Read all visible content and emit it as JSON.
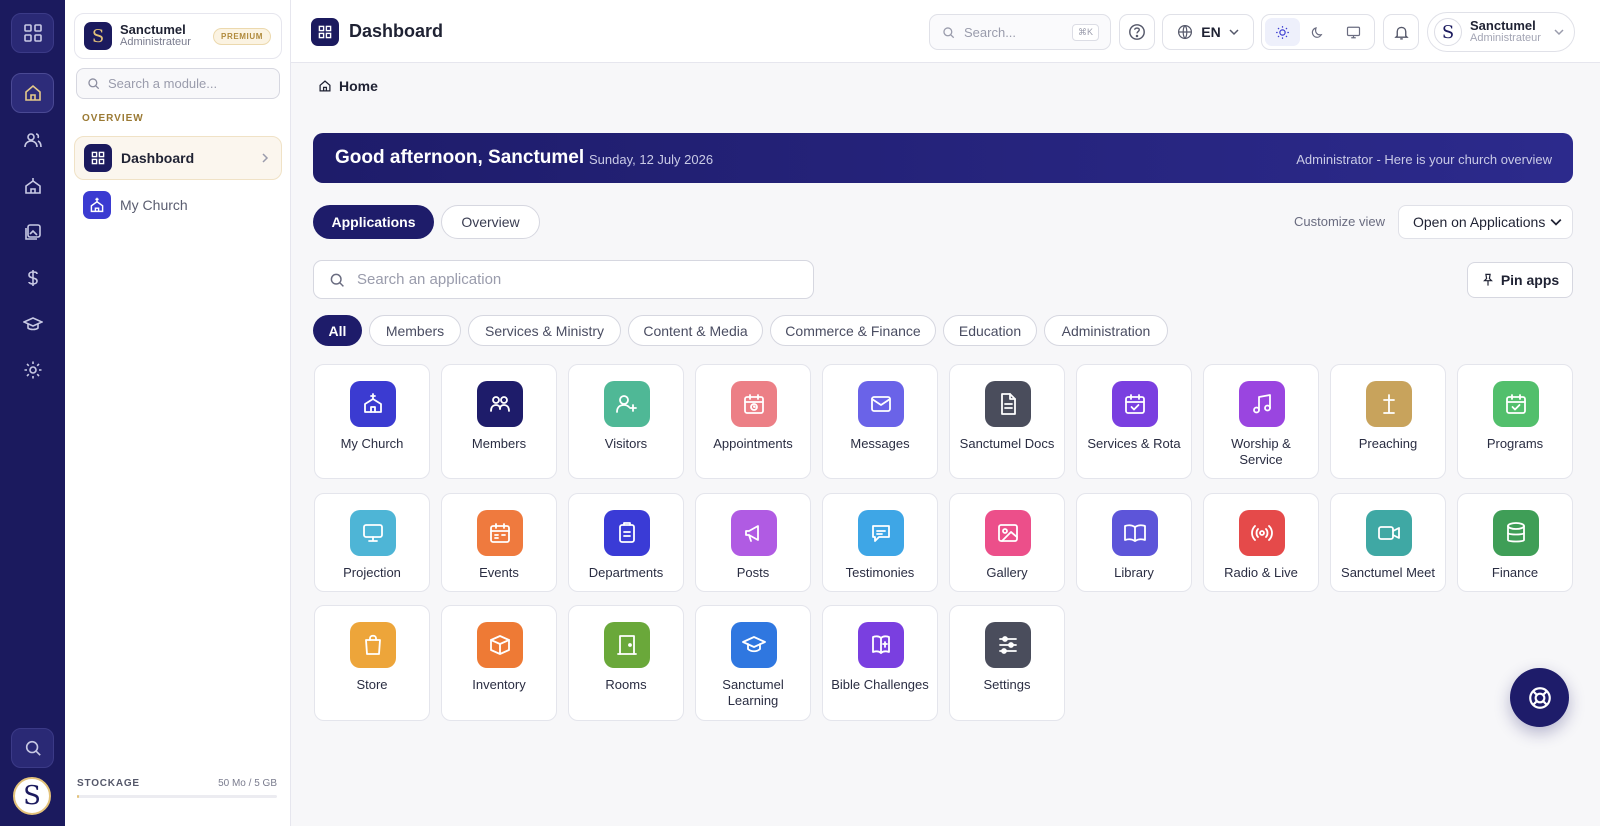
{
  "rail": {
    "items": [
      "apps-grid-icon",
      "home-icon",
      "users-icon",
      "church-icon",
      "media-icon",
      "dollar-icon",
      "graduation-cap-icon",
      "gear-icon"
    ],
    "search_icon": "search-icon",
    "avatar_letter": "S"
  },
  "sidebar": {
    "org_logo": "S",
    "org_name": "Sanctumel",
    "org_role": "Administrateur",
    "badge": "PREMIUM",
    "search_placeholder": "Search a module...",
    "section_label": "OVERVIEW",
    "items": [
      {
        "label": "Dashboard",
        "icon": "dashboard-icon",
        "active": true
      },
      {
        "label": "My Church",
        "icon": "church-icon",
        "active": false
      }
    ],
    "storage_label": "STOCKAGE",
    "storage_value": "50 Mo / 5 GB",
    "storage_fraction": 0.01
  },
  "header": {
    "title": "Dashboard",
    "search_placeholder": "Search...",
    "search_shortcut": "⌘K",
    "language": "EN",
    "user_name": "Sanctumel",
    "user_role": "Administrateur",
    "user_avatar": "S",
    "theme_selected": "light"
  },
  "breadcrumb": {
    "label": "Home"
  },
  "banner": {
    "greeting": "Good afternoon, Sanctumel",
    "date": "Sunday, 12 July 2026",
    "subtitle": "Administrator - Here is your church overview"
  },
  "tabs": [
    {
      "label": "Applications",
      "active": true
    },
    {
      "label": "Overview",
      "active": false
    }
  ],
  "customize": {
    "label": "Customize view",
    "selected": "Open on Applications"
  },
  "app_search": {
    "placeholder": "Search an application"
  },
  "pin_button": {
    "label": "Pin apps"
  },
  "filters": [
    {
      "label": "All",
      "active": true
    },
    {
      "label": "Members",
      "active": false
    },
    {
      "label": "Services & Ministry",
      "active": false
    },
    {
      "label": "Content & Media",
      "active": false
    },
    {
      "label": "Commerce & Finance",
      "active": false
    },
    {
      "label": "Education",
      "active": false
    },
    {
      "label": "Administration",
      "active": false
    }
  ],
  "apps": [
    {
      "label": "My Church",
      "icon": "church-icon",
      "color": "#3b3bd1"
    },
    {
      "label": "Members",
      "icon": "users-icon",
      "color": "#1e1c6a"
    },
    {
      "label": "Visitors",
      "icon": "user-plus-icon",
      "color": "#4fb896"
    },
    {
      "label": "Appointments",
      "icon": "calendar-clock-icon",
      "color": "#ec7f86"
    },
    {
      "label": "Messages",
      "icon": "mail-icon",
      "color": "#6a63e8"
    },
    {
      "label": "Sanctumel Docs",
      "icon": "document-icon",
      "color": "#4a4d5c"
    },
    {
      "label": "Services & Rota",
      "icon": "calendar-check-icon",
      "color": "#7a3fe0"
    },
    {
      "label": "Worship & Service",
      "icon": "music-icon",
      "color": "#9a45e0"
    },
    {
      "label": "Preaching",
      "icon": "cross-icon",
      "color": "#c8a35c"
    },
    {
      "label": "Programs",
      "icon": "calendar-check-icon",
      "color": "#52bf6c"
    },
    {
      "label": "Projection",
      "icon": "monitor-icon",
      "color": "#4eb5d6"
    },
    {
      "label": "Events",
      "icon": "calendar-icon",
      "color": "#ef7a3e"
    },
    {
      "label": "Departments",
      "icon": "clipboard-icon",
      "color": "#3a3bd6"
    },
    {
      "label": "Posts",
      "icon": "megaphone-icon",
      "color": "#b05be3"
    },
    {
      "label": "Testimonies",
      "icon": "chat-icon",
      "color": "#3ea6e6"
    },
    {
      "label": "Gallery",
      "icon": "image-icon",
      "color": "#ec4f8a"
    },
    {
      "label": "Library",
      "icon": "book-open-icon",
      "color": "#5d55d9"
    },
    {
      "label": "Radio & Live",
      "icon": "broadcast-icon",
      "color": "#e54a4a"
    },
    {
      "label": "Sanctumel Meet",
      "icon": "video-icon",
      "color": "#3fa8a4"
    },
    {
      "label": "Finance",
      "icon": "database-icon",
      "color": "#3f9e57"
    },
    {
      "label": "Store",
      "icon": "shopping-bag-icon",
      "color": "#eda53a"
    },
    {
      "label": "Inventory",
      "icon": "box-icon",
      "color": "#ee7a35"
    },
    {
      "label": "Rooms",
      "icon": "door-icon",
      "color": "#6aa83a"
    },
    {
      "label": "Sanctumel Learning",
      "icon": "graduation-cap-icon",
      "color": "#2f77e0"
    },
    {
      "label": "Bible Challenges",
      "icon": "bible-icon",
      "color": "#7a3fe0"
    },
    {
      "label": "Settings",
      "icon": "sliders-icon",
      "color": "#4a4d5c"
    }
  ]
}
